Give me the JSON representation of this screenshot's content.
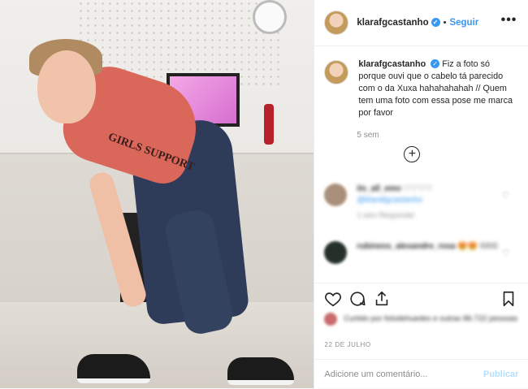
{
  "post": {
    "username": "klarafgcastanho",
    "follow_label": "Seguir",
    "separator": "•",
    "more_label": "•••",
    "caption": "Fiz a foto só porque ouvi que o cabelo tá parecido com o da Xuxa hahahahahah // Quem tem uma foto com essa pose me marca por favor",
    "time": "5 sem",
    "load_more_label": "+",
    "shirt_text": "GIRLS SUPPORT",
    "verified_mark": "✓"
  },
  "comments": [
    {
      "user": "its_all_emo",
      "text": "♡♡♡♡",
      "mention": "@klarafgcastanho",
      "meta": "1 sem   Responder"
    },
    {
      "user": "rubineos_alexandre_rosa",
      "text": "😍😍 ©©©",
      "meta": ""
    }
  ],
  "likes_text": "Curtido por fotodehuedes e outras 86.722 pessoas",
  "date": "22 DE JULHO",
  "add_comment": {
    "placeholder": "Adicione um comentário...",
    "publish_label": "Publicar"
  },
  "colors": {
    "accent": "#3897f0",
    "publish_disabled": "#b2dffc",
    "muted": "#8e8e8e"
  }
}
